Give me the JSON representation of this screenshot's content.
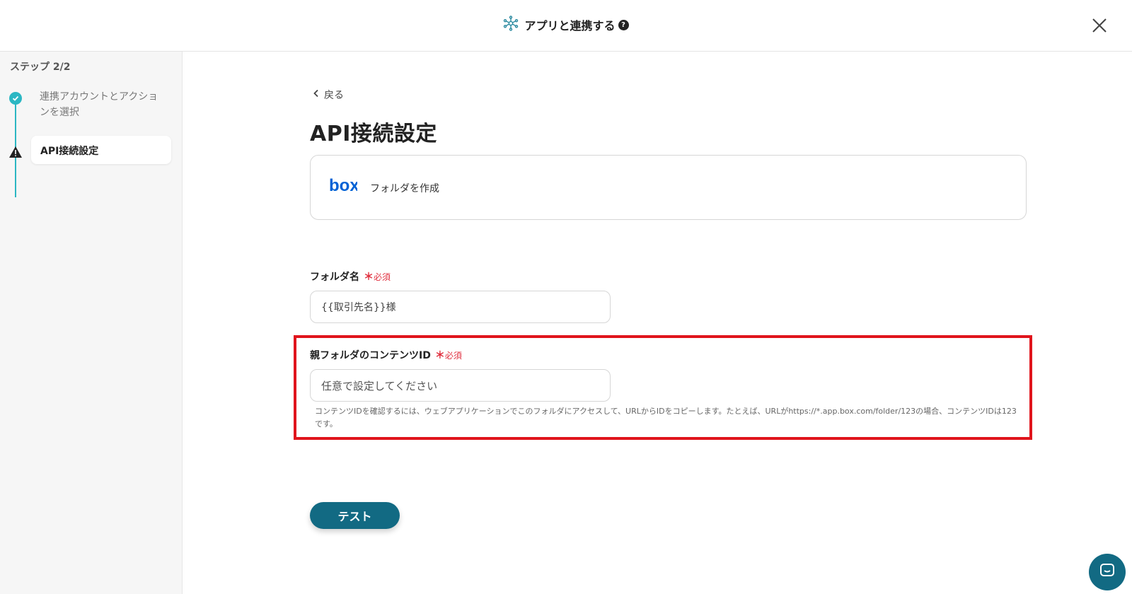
{
  "header": {
    "title": "アプリと連携する",
    "help_icon_glyph": "?",
    "connect_icon": "network-icon",
    "close_icon": "close-icon"
  },
  "sidebar": {
    "step_count": "ステップ 2/2",
    "steps": [
      {
        "label": "連携アカウントとアクションを選択",
        "status": "completed",
        "icon": "check-circle-icon"
      },
      {
        "label": "API接続設定",
        "status": "warning",
        "icon": "warning-triangle-icon"
      }
    ]
  },
  "main": {
    "back_label": "戻る",
    "page_title": "API接続設定",
    "app_card": {
      "app_logo_text": "box",
      "action_label": "フォルダを作成"
    },
    "fields": [
      {
        "label": "フォルダ名",
        "required_star": "＊",
        "required_text": "必須",
        "value": "{{取引先名}}様",
        "placeholder": ""
      },
      {
        "label": "親フォルダのコンテンツID",
        "required_star": "＊",
        "required_text": "必須",
        "value": "",
        "placeholder": "任意で設定してください",
        "help_text": "コンテンツIDを確認するには、ウェブアプリケーションでこのフォルダにアクセスして、URLからIDをコピーします。たとえば、URLがhttps://*.app.box.com/folder/123の場合、コンテンツIDは123です。"
      }
    ],
    "test_button_label": "テスト"
  },
  "colors": {
    "accent": "#2bb7c3",
    "primary_button": "#126a83",
    "required": "#e0303f",
    "highlight": "#e0141c",
    "box_brand": "#0061d5"
  }
}
